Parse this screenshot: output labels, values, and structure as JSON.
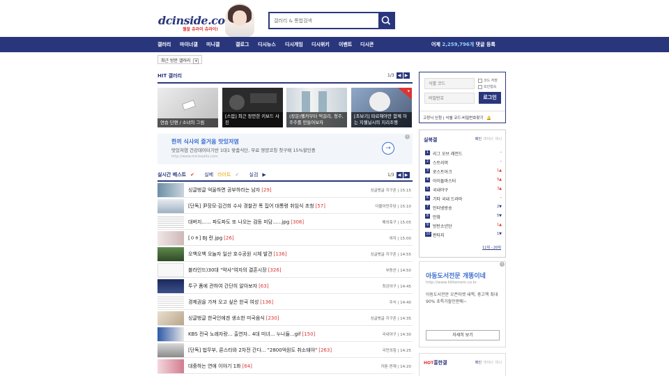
{
  "header": {
    "logo": "dcinside.com",
    "logo_tagline": "젤잘 츄라이 츄라이!",
    "search_placeholder": "갤러리 & 통합검색"
  },
  "nav": {
    "items": [
      "갤러리",
      "마이너갤",
      "미니갤",
      "갤로그",
      "디시뉴스",
      "디시게임",
      "디시위키",
      "이벤트",
      "디시콘"
    ],
    "comment_count_prefix": "어제",
    "comment_count": "2,259,796개",
    "comment_count_suffix": "댓글 등록"
  },
  "recent_gallery": {
    "label": "최근 방문 갤러리"
  },
  "hit": {
    "title": "HIT 갤러리",
    "page": "1/3",
    "items": [
      {
        "caption": "연습 단편 / 소녀의 그림"
      },
      {
        "caption": "[스압] 최근 장만한 키보드 사진"
      },
      {
        "caption": "(장문)펠카부터 억걸리, 청주, 주주를 만들어보자"
      },
      {
        "caption": "[초보기] 따료해야만 함께 하는 지젤닐시의 지리조행"
      }
    ]
  },
  "ad_main": {
    "title": "한끼 식사의 즐거움 맛있저염",
    "desc": "맛있저염 건강데이터기반 1대1 맞춤식단, 무료 영양코칭 첫구매 15%할인중",
    "url": "http://www.microsalts.com"
  },
  "realtime": {
    "tab1": "실시간 베스트",
    "tab2_a": "실베",
    "tab2_b": "라이트",
    "tab3": "실검",
    "page": "1/3",
    "rows": [
      {
        "title": "싱글벙글 억울하면 공부하라는 남자",
        "count": "[29]",
        "gallery": "싱글벙글 지구촌",
        "time": "15:15"
      },
      {
        "title": "[단독] 尹장모·김건희 수사 경찰관 폭 집어 대통령 취임식 초청",
        "count": "[57]",
        "gallery": "더불어민주당",
        "time": "15:10"
      },
      {
        "title": "대버지...... 파도파도 또 나오는 검등 미담......jpg",
        "count": "[308]",
        "gallery": "해외축구",
        "time": "15:05"
      },
      {
        "title": "[ㅇㅎ] BJ 란.jpg",
        "count": "[26]",
        "gallery": "여자",
        "time": "15:00"
      },
      {
        "title": "오백오백 오늘자 일산 호수공원 시체 발견",
        "count": "[136]",
        "gallery": "싱글벙글 지구촌",
        "time": "14:55"
      },
      {
        "title": "블라인드)30대 \"약사\"여자의 결혼시장",
        "count": "[326]",
        "gallery": "부동산",
        "time": "14:50"
      },
      {
        "title": "투구 폼에 관하여 간단히 알아보자",
        "count": "[63]",
        "gallery": "최강야구",
        "time": "14:45"
      },
      {
        "title": "경제권을 가져 오고 싶은 한국 여성",
        "count": "[136]",
        "gallery": "주식",
        "time": "14:40"
      },
      {
        "title": "싱글벙글 한국인에겐 생소한 미국음식",
        "count": "[230]",
        "gallery": "싱글벙글 지구촌",
        "time": "14:35"
      },
      {
        "title": "KBS 전국 노래자랑... 출연자.. 4대 미녀... 누나들...gif",
        "count": "[150]",
        "gallery": "국내야구",
        "time": "14:30"
      },
      {
        "title": "[단독] 법무부, 론스타와 2차전 간다... \"2800억원도 취소돼야\"",
        "count": "[263]",
        "gallery": "국민의힘",
        "time": "14:25"
      },
      {
        "title": "대중하는 연애 이야기 1화",
        "count": "[64]",
        "gallery": "카툰-연재",
        "time": "14:20"
      }
    ]
  },
  "login": {
    "id_placeholder": "식별 코드",
    "pw_placeholder": "비밀번호",
    "save_code": "코드 저장",
    "secure": "보안접속",
    "login_btn": "로그인",
    "fixed_apply": "고정닉 신청",
    "find": "식별 코드·비밀번호찾기"
  },
  "realbook": {
    "title": "실북갤",
    "tabs": [
      "메인",
      "마이너",
      "미니"
    ],
    "items": [
      {
        "rank": "1",
        "name": "리그 오브 레전드",
        "change": "–"
      },
      {
        "rank": "2",
        "name": "스트리머",
        "change": "–"
      },
      {
        "rank": "3",
        "name": "로스트아크",
        "change": "1"
      },
      {
        "rank": "4",
        "name": "아이돌마스터",
        "change": "9"
      },
      {
        "rank": "5",
        "name": "국내야구",
        "change": "3"
      },
      {
        "rank": "6",
        "name": "기타 국내 드라마",
        "change": "–"
      },
      {
        "rank": "7",
        "name": "인터넷방송",
        "change": "2"
      },
      {
        "rank": "8",
        "name": "만화",
        "change": "5"
      },
      {
        "rank": "9",
        "name": "방탄소년단",
        "change": "1"
      },
      {
        "rank": "10",
        "name": "판타지",
        "change": "1"
      }
    ],
    "more": "11위 - 20위"
  },
  "ad_side": {
    "title": "아동도서전문 개똥이네",
    "url": "http://www.littlemom.co.kr",
    "desc": "아동도서전문 오픈마켓 새책, 중고책 최대 90% 초특가할인판매~",
    "button": "자세히 보기"
  },
  "hot_gallery": {
    "hot": "HOT",
    "title": "흥한갤",
    "tabs": [
      "메인",
      "마이너",
      "미니"
    ]
  },
  "colors": {
    "brand": "#29367c",
    "accent": "#d33",
    "link": "#3a6dd0"
  }
}
